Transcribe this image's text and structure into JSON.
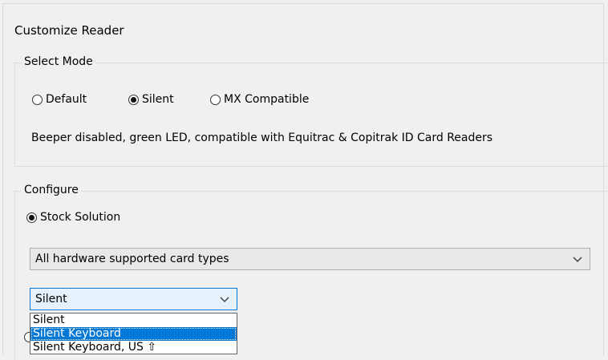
{
  "header": {
    "title": "Customize Reader"
  },
  "select_mode": {
    "legend": "Select Mode",
    "options": [
      {
        "label": "Default",
        "selected": false
      },
      {
        "label": "Silent",
        "selected": true
      },
      {
        "label": "MX Compatible",
        "selected": false
      }
    ],
    "description": "Beeper disabled, green LED, compatible with Equitrac & Copitrak ID Card Readers"
  },
  "configure": {
    "legend": "Configure",
    "stock_solution_label": "Stock Solution",
    "stock_solution_selected": true,
    "card_types_value": "All hardware supported card types",
    "mode_value": "Silent",
    "dropdown_items": [
      "Silent",
      "Silent Keyboard",
      "Silent Keyboard, US ⇧"
    ],
    "dropdown_highlighted_index": 1
  },
  "colors": {
    "highlight": "#0078d7",
    "background": "#f0f0f0"
  }
}
